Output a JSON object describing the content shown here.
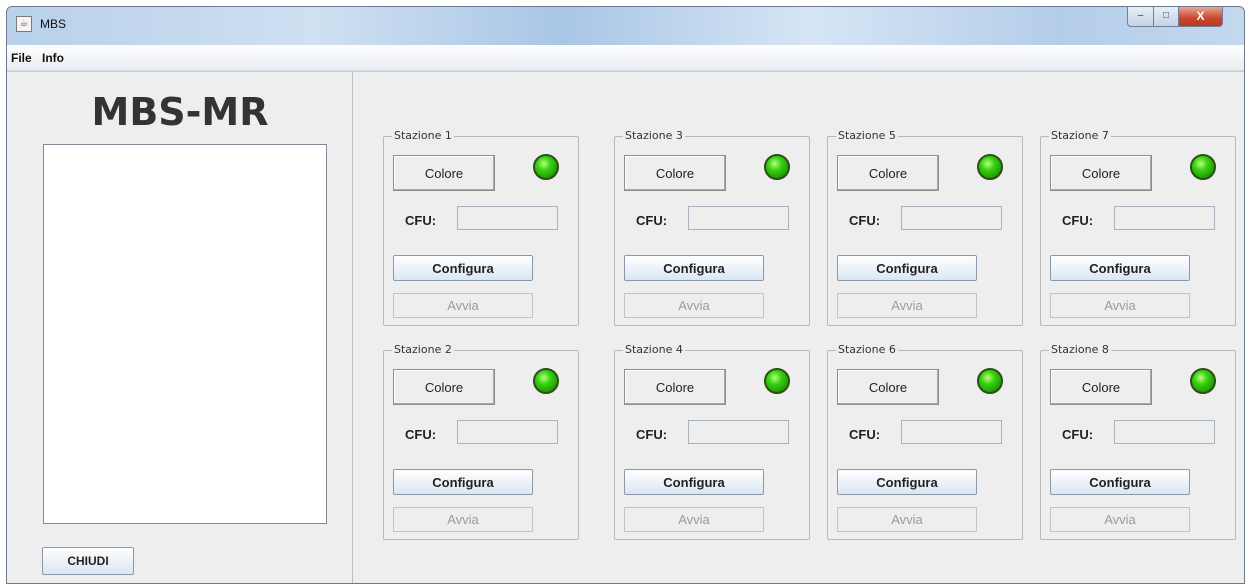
{
  "window": {
    "title": "MBS",
    "app_icon": "java-cup-icon",
    "controls": {
      "minimize": "–",
      "maximize": "□",
      "close": "X"
    }
  },
  "menu": {
    "items": [
      "File",
      "Info"
    ]
  },
  "left_panel": {
    "heading": "MBS-MR",
    "log_area_value": "",
    "close_button": "CHIUDI"
  },
  "stations": [
    {
      "title": "Stazione 1",
      "color_button": "Colore",
      "cfu_label": "CFU:",
      "cfu_value": "",
      "configure_button": "Configura",
      "start_button": "Avvia",
      "led_status": "green"
    },
    {
      "title": "Stazione 2",
      "color_button": "Colore",
      "cfu_label": "CFU:",
      "cfu_value": "",
      "configure_button": "Configura",
      "start_button": "Avvia",
      "led_status": "green"
    },
    {
      "title": "Stazione 3",
      "color_button": "Colore",
      "cfu_label": "CFU:",
      "cfu_value": "",
      "configure_button": "Configura",
      "start_button": "Avvia",
      "led_status": "green"
    },
    {
      "title": "Stazione 4",
      "color_button": "Colore",
      "cfu_label": "CFU:",
      "cfu_value": "",
      "configure_button": "Configura",
      "start_button": "Avvia",
      "led_status": "green"
    },
    {
      "title": "Stazione 5",
      "color_button": "Colore",
      "cfu_label": "CFU:",
      "cfu_value": "",
      "configure_button": "Configura",
      "start_button": "Avvia",
      "led_status": "green"
    },
    {
      "title": "Stazione 6",
      "color_button": "Colore",
      "cfu_label": "CFU:",
      "cfu_value": "",
      "configure_button": "Configura",
      "start_button": "Avvia",
      "led_status": "green"
    },
    {
      "title": "Stazione 7",
      "color_button": "Colore",
      "cfu_label": "CFU:",
      "cfu_value": "",
      "configure_button": "Configura",
      "start_button": "Avvia",
      "led_status": "green"
    },
    {
      "title": "Stazione 8",
      "color_button": "Colore",
      "cfu_label": "CFU:",
      "cfu_value": "",
      "configure_button": "Configura",
      "start_button": "Avvia",
      "led_status": "green"
    }
  ],
  "colors": {
    "led_green": "#2fc00e",
    "window_frame": "#b9d1ea",
    "panel_background": "#eeeeee"
  }
}
